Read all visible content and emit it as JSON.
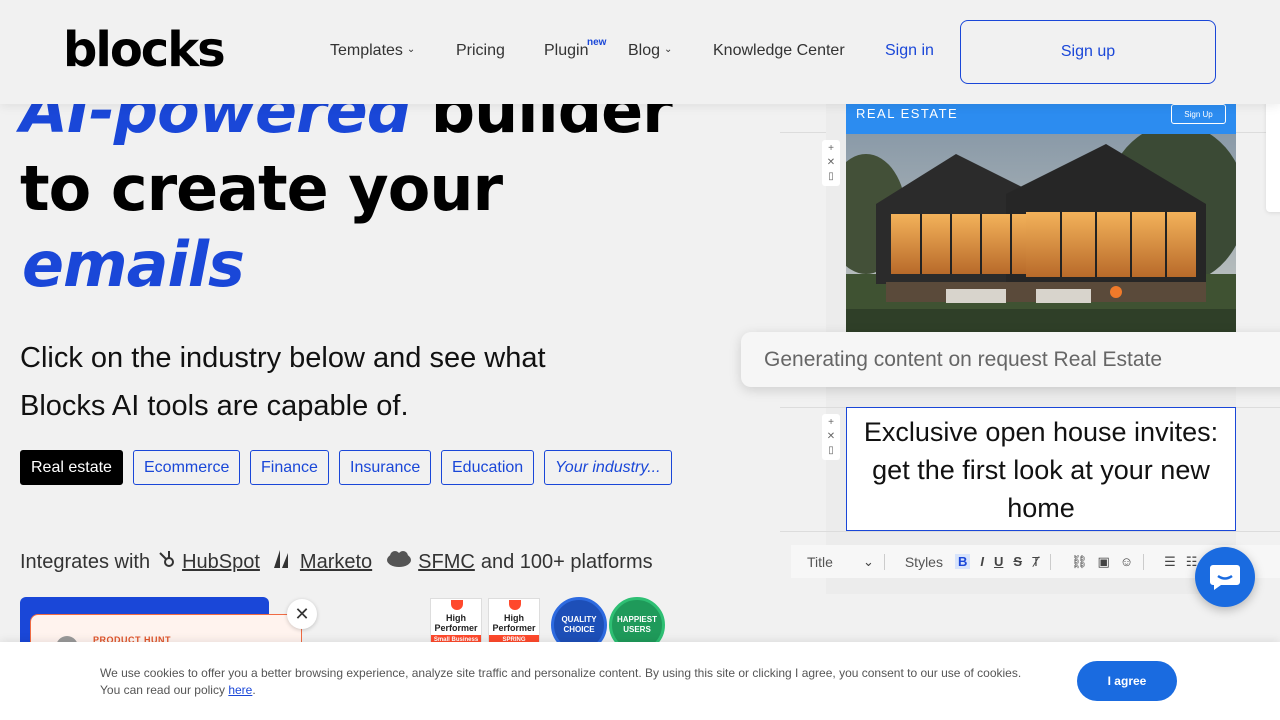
{
  "header": {
    "logo": "blocks",
    "nav": [
      {
        "label": "Templates"
      },
      {
        "label": "Pricing"
      },
      {
        "label": "Plugin",
        "badge": "new"
      },
      {
        "label": "Blog"
      },
      {
        "label": "Knowledge Center"
      }
    ],
    "sign_in": "Sign in",
    "sign_up": "Sign up"
  },
  "hero": {
    "line1_blue": "AI-powered",
    "line1_black": "builder",
    "line2": "to create your",
    "line3": "emails",
    "subtitle": "Click on the industry below and see what Blocks AI tools are capable of."
  },
  "industries": [
    {
      "label": "Real estate",
      "active": true
    },
    {
      "label": "Ecommerce"
    },
    {
      "label": "Finance"
    },
    {
      "label": "Insurance"
    },
    {
      "label": "Education"
    },
    {
      "label": "Your industry..."
    }
  ],
  "integrations": {
    "prefix": "Integrates with",
    "items": [
      "HubSpot",
      "Marketo",
      "SFMC"
    ],
    "suffix": "and 100+ platforms"
  },
  "product_hunt": {
    "label": "PRODUCT HUNT"
  },
  "badges": [
    {
      "title": "High Performer",
      "sub": "Small Business"
    },
    {
      "title": "High Performer",
      "sub": "SPRING"
    },
    {
      "title": "QUALITY CHOICE"
    },
    {
      "title": "HAPPIEST USERS"
    }
  ],
  "email_preview": {
    "section_label": "REAL ESTATE",
    "signup_small": "Sign Up",
    "generating": "Generating content on request Real Estate",
    "headline": "Exclusive open house invites: get the first look at your new home",
    "format_bar": {
      "title": "Title",
      "styles": "Styles"
    }
  },
  "cookie": {
    "text": "We use cookies to offer you a better browsing experience, analyze site traffic and personalize content. By using this site or clicking I agree, you consent to our use of cookies. You can read our policy",
    "link": "here",
    "button": "I agree"
  },
  "colors": {
    "accent": "#1a47d8",
    "chat_button": "#1a6be0",
    "email_header": "#2c8cf0"
  }
}
